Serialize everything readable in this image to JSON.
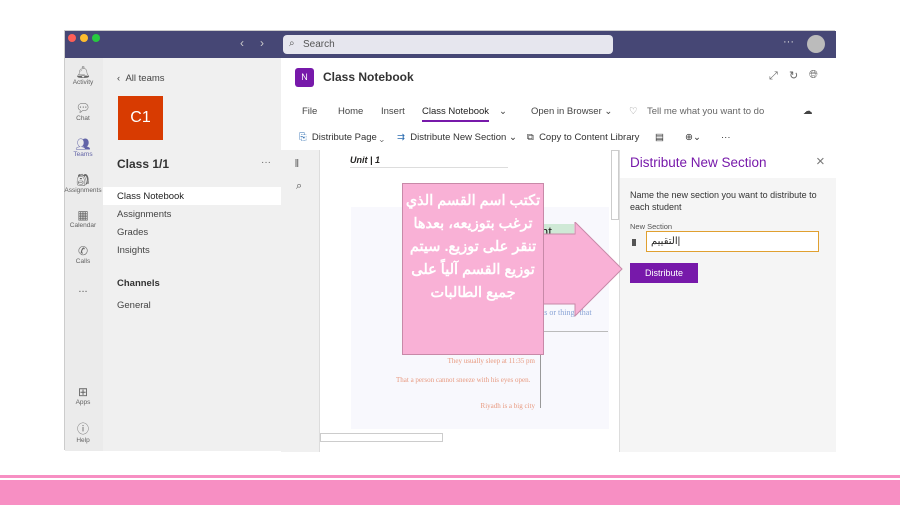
{
  "titlebar": {
    "search_placeholder": "Search"
  },
  "rail": [
    {
      "label": "Activity",
      "icon": "bell-icon"
    },
    {
      "label": "Chat",
      "icon": "chat-icon"
    },
    {
      "label": "Teams",
      "icon": "teams-icon"
    },
    {
      "label": "Assignments",
      "icon": "assignments-icon"
    },
    {
      "label": "Calendar",
      "icon": "calendar-icon"
    },
    {
      "label": "Calls",
      "icon": "phone-icon"
    },
    {
      "label": "...",
      "icon": "more-icon"
    },
    {
      "label": "Apps",
      "icon": "apps-icon"
    },
    {
      "label": "Help",
      "icon": "help-icon"
    }
  ],
  "team": {
    "back": "All teams",
    "avatar": "C1",
    "name": "Class 1/1",
    "items": [
      "Class Notebook",
      "Assignments",
      "Grades",
      "Insights"
    ],
    "channels_heading": "Channels",
    "channels": [
      "General"
    ]
  },
  "notebook": {
    "title": "Class Notebook",
    "tabs": [
      "File",
      "Home",
      "Insert",
      "Class Notebook",
      "Open in Browser"
    ],
    "active_tab": "Class Notebook",
    "tell_me": "Tell me what you want to do",
    "toolbar": [
      "Distribute Page",
      "Distribute New Section",
      "Copy to Content Library"
    ]
  },
  "page": {
    "title": "Unit | 1",
    "heading_fragment": "nt",
    "blue_text": "ts or things that",
    "notes": [
      "They usually sleep at 11:35 pm",
      "That a person cannot sneeze with his eyes open.",
      "Riyadh is a big city"
    ]
  },
  "callout": {
    "text": "تكتب اسم القسم الذي ترغب بتوزيعه، بعدها تنقر على توزيع. سيتم توزيع القسم آلياً على جميع الطالبات"
  },
  "panel": {
    "title": "Distribute New Section",
    "description": "Name the new section you want to distribute to each student",
    "field_label": "New Section",
    "field_value": "التقييم",
    "button": "Distribute"
  },
  "colors": {
    "accent": "#7719aa",
    "titlebar": "#464775",
    "callout": "#f9b1d6",
    "bottom_band": "#f78fc3"
  }
}
